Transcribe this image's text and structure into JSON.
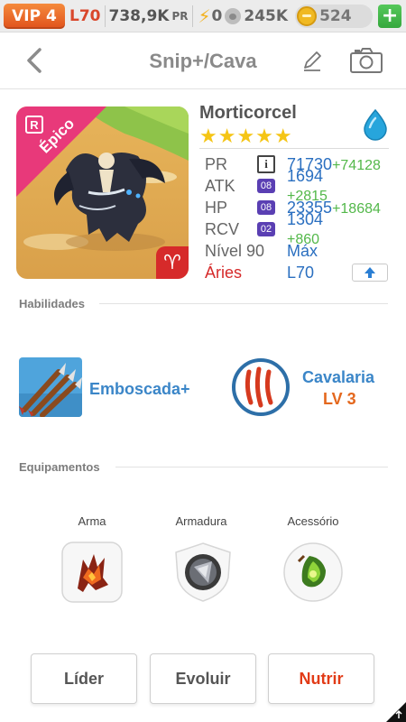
{
  "status": {
    "vip": "VIP 4",
    "level": "L70",
    "power": "738,9K",
    "power_unit": "PR",
    "stamina": "0",
    "food": "245K",
    "gold": "524",
    "add": "+"
  },
  "header": {
    "title": "Snip+/Cava"
  },
  "hero": {
    "rarity": "Épico",
    "rarity_color": "#e8397a",
    "r_badge": "R",
    "name": "Morticorcel",
    "stars": "★★★★★",
    "zodiac_symbol": "♈",
    "element": "water",
    "stats": [
      {
        "label": "PR",
        "badge": "i",
        "value": "71730",
        "bonus": "+74128"
      },
      {
        "label": "ATK",
        "badge": "08",
        "value": "1694",
        "bonus": "+2815"
      },
      {
        "label": "HP",
        "badge": "08",
        "value": "23355",
        "bonus": "+18684"
      },
      {
        "label": "RCV",
        "badge": "02",
        "value": "1304",
        "bonus": "+860"
      },
      {
        "label": "Nível 90",
        "badge": "",
        "value": "Máx",
        "bonus": ""
      },
      {
        "label": "Áries",
        "badge": "",
        "value": "L70",
        "bonus": ""
      }
    ]
  },
  "skills": {
    "title": "Habilidades",
    "items": [
      {
        "name": "Emboscada+",
        "level": ""
      },
      {
        "name": "Cavalaria",
        "level": "LV 3"
      }
    ]
  },
  "equipment": {
    "title": "Equipamentos",
    "slots": [
      {
        "label": "Arma"
      },
      {
        "label": "Armadura"
      },
      {
        "label": "Acessório"
      }
    ]
  },
  "actions": {
    "leader": "Líder",
    "evolve": "Evoluir",
    "feed": "Nutrir"
  }
}
